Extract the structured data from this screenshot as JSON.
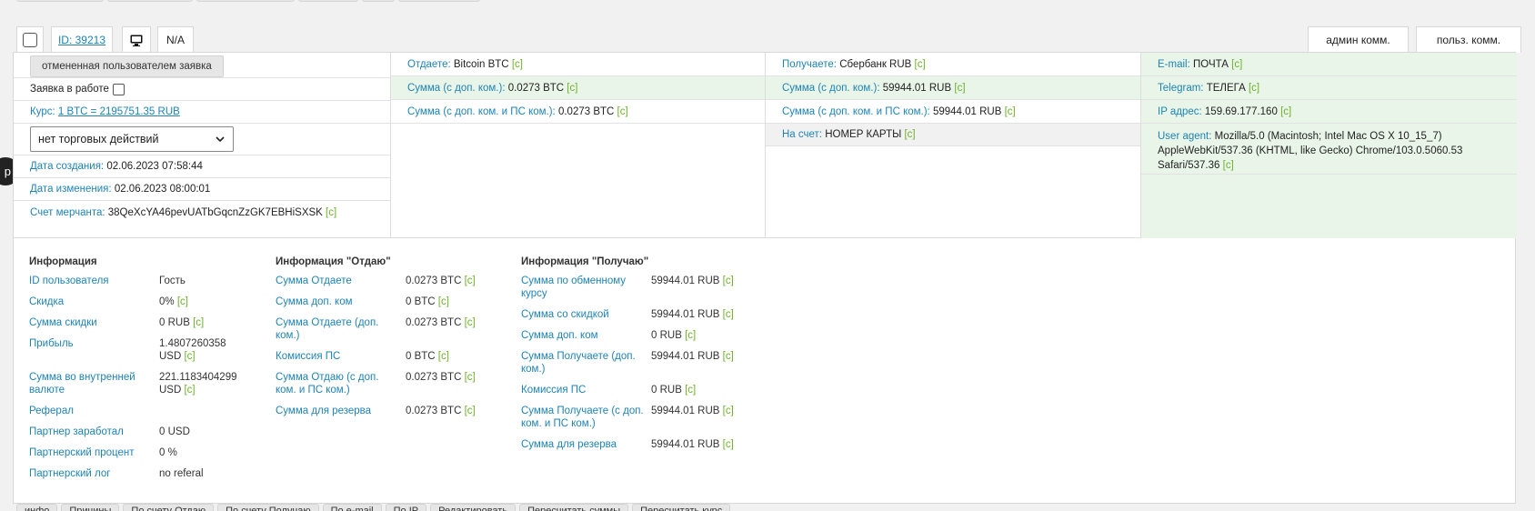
{
  "header": {
    "id_label": "ID: 39213",
    "na_label": "N/A",
    "admin_comment_label": "админ комм.",
    "user_comment_label": "польз. комм."
  },
  "badge": "p",
  "col1": {
    "cancel_button": "отмененная пользователем заявка",
    "in_work_label": "Заявка в работе",
    "rate_label": "Курс:",
    "rate_value": "1 BTC = 2195751.35 RUB",
    "select_value": "нет торговых действий",
    "created_label": "Дата создания:",
    "created_value": "02.06.2023 07:58:44",
    "changed_label": "Дата изменения:",
    "changed_value": "02.06.2023 08:00:01",
    "merchant_label": "Счет мерчанта:",
    "merchant_value": "38QeXcYA46pevUATbGqcnZzGK7EBHiSXSK",
    "c": "[c]"
  },
  "col2": [
    {
      "label": "Отдаете:",
      "value": "Bitcoin BTC"
    },
    {
      "label": "Сумма (с доп. ком.):",
      "value": "0.0273 BTC"
    },
    {
      "label": "Сумма (с доп. ком. и ПС ком.):",
      "value": "0.0273 BTC"
    }
  ],
  "col3": [
    {
      "label": "Получаете:",
      "value": "Сбербанк RUB"
    },
    {
      "label": "Сумма (с доп. ком.):",
      "value": "59944.01 RUB"
    },
    {
      "label": "Сумма (с доп. ком. и ПС ком.):",
      "value": "59944.01 RUB"
    },
    {
      "label": "На счет:",
      "value": "НОМЕР КАРТЫ"
    }
  ],
  "col4": [
    {
      "label": "E-mail:",
      "value": "ПОЧТА"
    },
    {
      "label": "Telegram:",
      "value": "ТЕЛЕГА"
    },
    {
      "label": "IP адрес:",
      "value": "159.69.177.160"
    },
    {
      "label": "User agent:",
      "value": "Mozilla/5.0 (Macintosh; Intel Mac OS X 10_15_7) AppleWebKit/537.36 (KHTML, like Gecko) Chrome/103.0.5060.53 Safari/537.36"
    }
  ],
  "info": {
    "title": "Информация",
    "rows": [
      {
        "k": "ID пользователя",
        "v": "Гость",
        "c": false
      },
      {
        "k": "Скидка",
        "v": "0%",
        "c": true
      },
      {
        "k": "Сумма скидки",
        "v": "0 RUB",
        "c": true
      },
      {
        "k": "Прибыль",
        "v": "1.4807260358 USD",
        "c": true
      },
      {
        "k": "Сумма во внутренней валюте",
        "v": "221.1183404299 USD",
        "c": true
      },
      {
        "k": "Реферал",
        "v": "",
        "c": false
      },
      {
        "k": "Партнер заработал",
        "v": "0 USD",
        "c": false
      },
      {
        "k": "Партнерский процент",
        "v": "0 %",
        "c": false
      },
      {
        "k": "Партнерский лог",
        "v": "no referal",
        "c": false
      }
    ]
  },
  "give": {
    "title": "Информация \"Отдаю\"",
    "rows": [
      {
        "k": "Сумма Отдаете",
        "v": "0.0273 BTC",
        "c": true
      },
      {
        "k": "Сумма доп. ком",
        "v": "0 BTC",
        "c": true
      },
      {
        "k": "Сумма Отдаете (доп. ком.)",
        "v": "0.0273 BTC",
        "c": true
      },
      {
        "k": "Комиссия ПС",
        "v": "0 BTC",
        "c": true
      },
      {
        "k": "Сумма Отдаю (с доп. ком. и ПС ком.)",
        "v": "0.0273 BTC",
        "c": true
      },
      {
        "k": "Сумма для резерва",
        "v": "0.0273 BTC",
        "c": true
      }
    ]
  },
  "get": {
    "title": "Информация \"Получаю\"",
    "rows": [
      {
        "k": "Сумма по обменному курсу",
        "v": "59944.01 RUB",
        "c": true
      },
      {
        "k": "Сумма со скидкой",
        "v": "59944.01 RUB",
        "c": true
      },
      {
        "k": "Сумма доп. ком",
        "v": "0 RUB",
        "c": true
      },
      {
        "k": "Сумма Получаете (доп. ком.)",
        "v": "59944.01 RUB",
        "c": true
      },
      {
        "k": "Комиссия ПС",
        "v": "0 RUB",
        "c": true
      },
      {
        "k": "Сумма Получаете (с доп. ком. и ПС ком.)",
        "v": "59944.01 RUB",
        "c": true
      },
      {
        "k": "Сумма для резерва",
        "v": "59944.01 RUB",
        "c": true
      }
    ]
  },
  "bottom_tabs": [
    "инфо",
    "Причины",
    "По счету Отдаю",
    "По счету Получаю",
    "По e-mail",
    "По IP",
    "Редактировать",
    "Пересчитать суммы",
    "Пересчитать курс"
  ]
}
